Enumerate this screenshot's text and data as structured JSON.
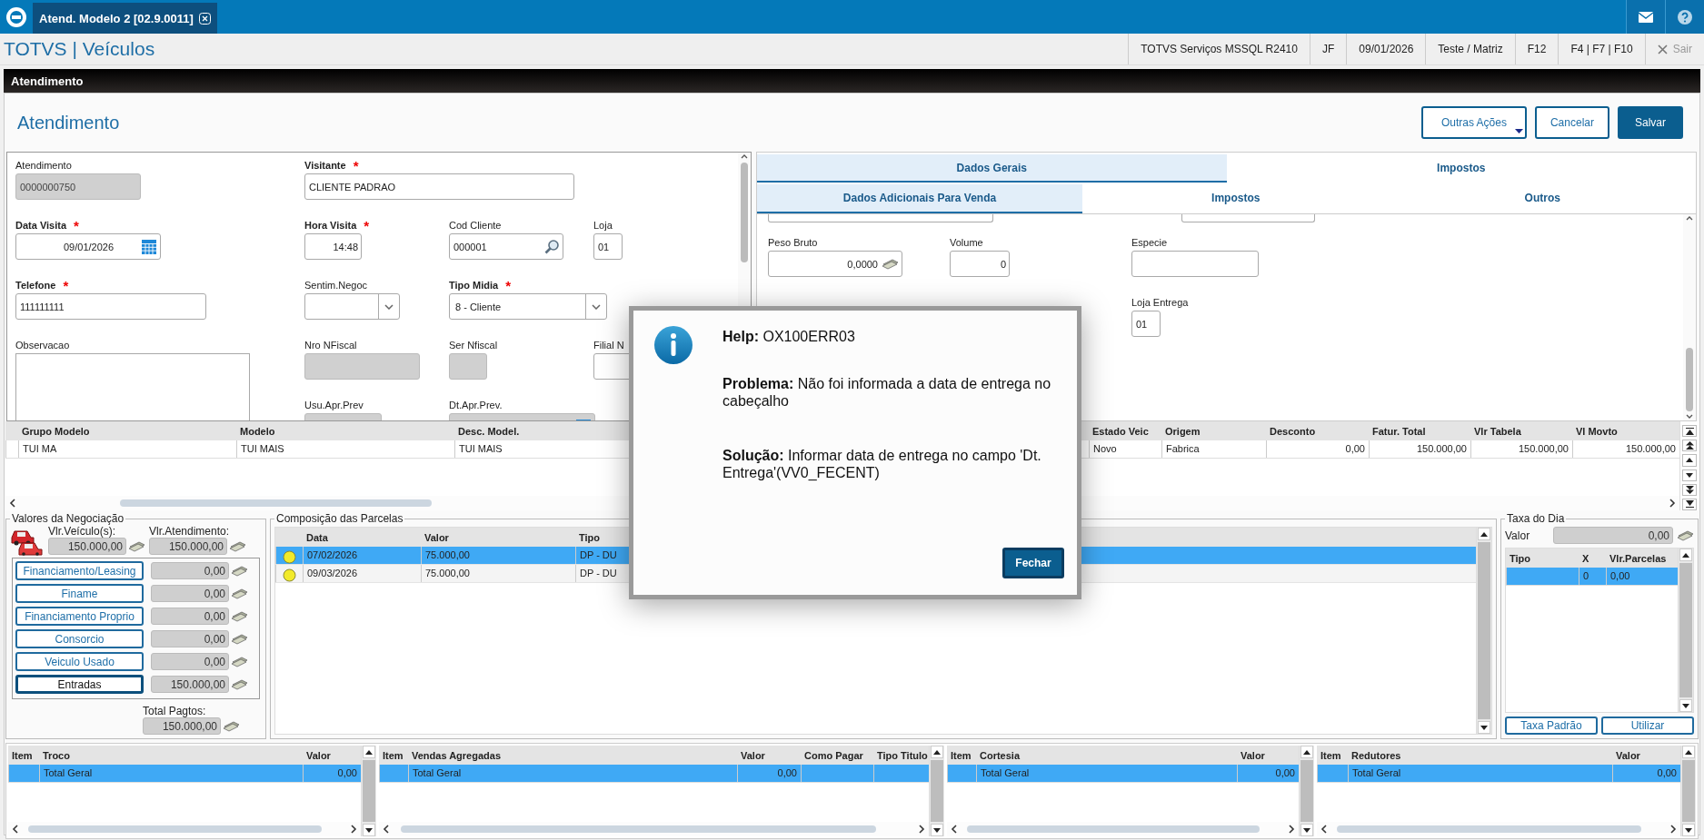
{
  "tab": {
    "title": "Atend. Modelo 2 [02.9.0011]"
  },
  "app_title": "TOTVS | Veículos",
  "status_items": [
    "TOTVS Serviços MSSQL R2410",
    "JF",
    "09/01/2026",
    "Teste / Matriz",
    "F12",
    "F4 | F7 | F10"
  ],
  "exit": {
    "label": "Sair",
    "disabled": true
  },
  "section_bar": "Atendimento",
  "page_title": "Atendimento",
  "actions": [
    {
      "label": "Outras Ações",
      "kind": "menu"
    },
    {
      "label": "Cancelar",
      "kind": "secondary"
    },
    {
      "label": "Salvar",
      "kind": "primary"
    }
  ],
  "form": {
    "fields": [
      {
        "label": "Atendimento",
        "kind": "text",
        "value": "0000000750",
        "disabled": true
      },
      {
        "label": "Visitante",
        "required_mark": "*",
        "kind": "text",
        "value": "CLIENTE PADRAO",
        "disabled": false
      },
      {
        "label": "Data Visita",
        "required_mark": "*",
        "kind": "date",
        "value": "09/01/2026",
        "disabled": false
      },
      {
        "label": "Hora Visita",
        "required_mark": "*",
        "kind": "number",
        "value": "14:48",
        "disabled": false
      },
      {
        "label": "Cod Cliente",
        "kind": "search",
        "value": "000001",
        "disabled": false
      },
      {
        "label": "Loja",
        "kind": "text",
        "value": "01",
        "disabled": false
      },
      {
        "label": "Telefone",
        "required_mark": "*",
        "kind": "text",
        "value": "111111111",
        "disabled": false
      },
      {
        "label": "Sentim.Negoc",
        "kind": "select",
        "disabled": false
      },
      {
        "label": "Tipo Midia",
        "required_mark": "*",
        "kind": "select",
        "value": "8 - Cliente",
        "disabled": false
      },
      {
        "label": "Observacao",
        "kind": "textarea",
        "disabled": false
      },
      {
        "label": "Nro NFiscal",
        "kind": "text",
        "disabled": true
      },
      {
        "label": "Ser Nfiscal",
        "kind": "text",
        "disabled": true
      },
      {
        "label": "Filial N",
        "kind": "text",
        "disabled": false
      },
      {
        "label": "Usu.Apr.Prev",
        "kind": "text",
        "disabled": true
      },
      {
        "label": "Dt.Apr.Prev.",
        "kind": "date",
        "disabled": true
      }
    ]
  },
  "tabs": [
    {
      "label": "Dados Gerais",
      "selected": true
    },
    {
      "label": "Impostos",
      "selected": false
    }
  ],
  "subtabs": [
    {
      "label": "Dados Adicionais Para Venda",
      "selected": true
    },
    {
      "label": "Impostos",
      "selected": false
    },
    {
      "label": "Outros",
      "selected": false
    }
  ],
  "detail_fields": [
    {
      "label": "Peso Bruto",
      "kind": "money",
      "value": "0,0000"
    },
    {
      "label": "Volume",
      "kind": "number",
      "value": "0"
    },
    {
      "label": "Especie",
      "kind": "text"
    },
    {
      "label": "Loja Entrega",
      "kind": "text",
      "value": "01"
    }
  ],
  "items_grid": {
    "columns": [
      "Grupo Modelo",
      "Modelo",
      "Desc. Model.",
      "Estado Veic",
      "Origem",
      "Desconto",
      "Fatur. Total",
      "Vlr Tabela",
      "Vl Movto"
    ],
    "rows": [
      [
        "TUI MA",
        "TUI MAIS",
        "TUI MAIS",
        "Novo",
        "Fabrica",
        "0,00",
        "150.000,00",
        "150.000,00",
        "150.000,00"
      ]
    ]
  },
  "negotiation": {
    "title": "Valores da Negociação",
    "vehicle": {
      "label": "Vlr.Veículo(s):",
      "value": "150.000,00"
    },
    "service": {
      "label": "Vlr.Atendimento:",
      "value": "150.000,00"
    },
    "payments": [
      {
        "label": "Financiamento/Leasing",
        "value": "0,00",
        "selected": false
      },
      {
        "label": "Finame",
        "value": "0,00",
        "selected": false
      },
      {
        "label": "Financiamento Proprio",
        "value": "0,00",
        "selected": false
      },
      {
        "label": "Consorcio",
        "value": "0,00",
        "selected": false
      },
      {
        "label": "Veiculo Usado",
        "value": "0,00",
        "selected": false
      },
      {
        "label": "Entradas",
        "value": "150.000,00",
        "selected": true
      }
    ],
    "total": {
      "label": "Total Pagtos:",
      "value": "150.000,00"
    }
  },
  "installments": {
    "title": "Composição das Parcelas",
    "columns": [
      "Data",
      "Valor",
      "Tipo"
    ],
    "rows": [
      {
        "cells": [
          "07/02/2026",
          "75.000,00",
          "DP - DU"
        ],
        "selected": true,
        "color": "#f2ea2a"
      },
      {
        "cells": [
          "09/03/2026",
          "75.000,00",
          "DP - DU"
        ],
        "selected": false,
        "color": "#f2ea2a"
      }
    ]
  },
  "daily_rate": {
    "title": "Taxa do Dia",
    "value_label": "Valor",
    "value": "0,00",
    "columns": [
      "Tipo",
      "X",
      "Vlr.Parcelas"
    ],
    "rows": [
      {
        "cells": [
          null,
          "0",
          "0,00"
        ],
        "selected": true
      }
    ],
    "buttons": [
      "Taxa Padrão",
      "Utilizar"
    ]
  },
  "totals_grids": [
    {
      "columns": [
        "Item",
        "Troco",
        "Valor"
      ],
      "rows": [
        {
          "cells": [
            null,
            "Total Geral",
            "0,00"
          ],
          "selected": true
        }
      ]
    },
    {
      "columns": [
        "Item",
        "Vendas Agregadas",
        "Valor",
        "Como Pagar",
        "Tipo Titulo"
      ],
      "rows": [
        {
          "cells": [
            null,
            "Total Geral",
            "0,00",
            null,
            null
          ],
          "selected": true
        }
      ]
    },
    {
      "columns": [
        "Item",
        "Cortesia",
        "Valor"
      ],
      "rows": [
        {
          "cells": [
            null,
            "Total Geral",
            "0,00"
          ],
          "selected": true
        }
      ]
    },
    {
      "columns": [
        "Item",
        "Redutores",
        "Valor"
      ],
      "rows": [
        {
          "cells": [
            null,
            "Total Geral",
            "0,00"
          ],
          "selected": true
        }
      ]
    }
  ],
  "dialog": {
    "heading": "**Help:** OX100ERR03",
    "problem": "**Problema:** Não foi informada a data de entrega no cabeçalho",
    "solution": "**Solução:** Informar data de entrega no campo 'Dt. Entrega'(VV0_FECENT)",
    "button": "Fechar"
  }
}
